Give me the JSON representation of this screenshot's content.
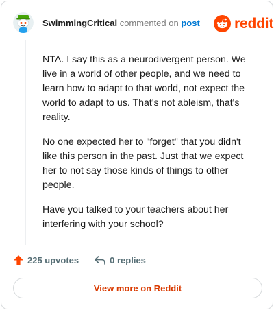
{
  "comment": {
    "username": "SwimmingCritical",
    "action_text": "commented on",
    "target_link": "post",
    "paragraphs": [
      "NTA. I say this as a neurodivergent person. We live in a world of other people, and we need to learn how to adapt to that world, not expect the world to adapt to us. That's not ableism, that's reality.",
      "No one expected her to \"forget\" that you didn't like this person in the past. Just that we expect her to not say those kinds of things to other people.",
      "Have you talked to your teachers about her interfering with your school?"
    ],
    "upvotes_label": "225 upvotes",
    "replies_label": "0 replies"
  },
  "brand": {
    "wordmark": "reddit",
    "color": "#ff4500",
    "icon": "reddit-snoo-icon"
  },
  "footer": {
    "view_more_label": "View more on Reddit"
  },
  "icons": {
    "upvote": "upvote-arrow-icon",
    "reply": "reply-arrow-icon",
    "avatar": "snoo-avatar"
  },
  "colors": {
    "upvote": "#ff4500",
    "link": "#0079d3",
    "view_more": "#d93a00",
    "muted": "#576f76"
  }
}
